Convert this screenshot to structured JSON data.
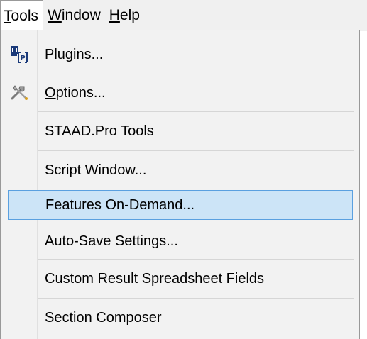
{
  "menubar": {
    "items": [
      {
        "label": "Tools",
        "active": true
      },
      {
        "label": "Window",
        "active": false
      },
      {
        "label": "Help",
        "active": false
      }
    ]
  },
  "tools_menu": {
    "items": [
      {
        "label": "Plugins...",
        "icon": "plugins-icon"
      },
      {
        "label": "Options...",
        "icon": "tools-options-icon"
      },
      {
        "label": "STAAD.Pro Tools",
        "icon": ""
      },
      {
        "label": "Script Window...",
        "icon": ""
      },
      {
        "label": "Features On-Demand...",
        "icon": "",
        "highlighted": true
      },
      {
        "label": "Auto-Save Settings...",
        "icon": ""
      },
      {
        "label": "Custom Result Spreadsheet Fields",
        "icon": ""
      },
      {
        "label": "Section Composer",
        "icon": ""
      }
    ]
  },
  "colors": {
    "menubar_bg": "#f0f0f0",
    "menu_bg": "#f2f2f2",
    "highlight_bg": "#cce4f7",
    "highlight_border": "#5aa0e0"
  }
}
